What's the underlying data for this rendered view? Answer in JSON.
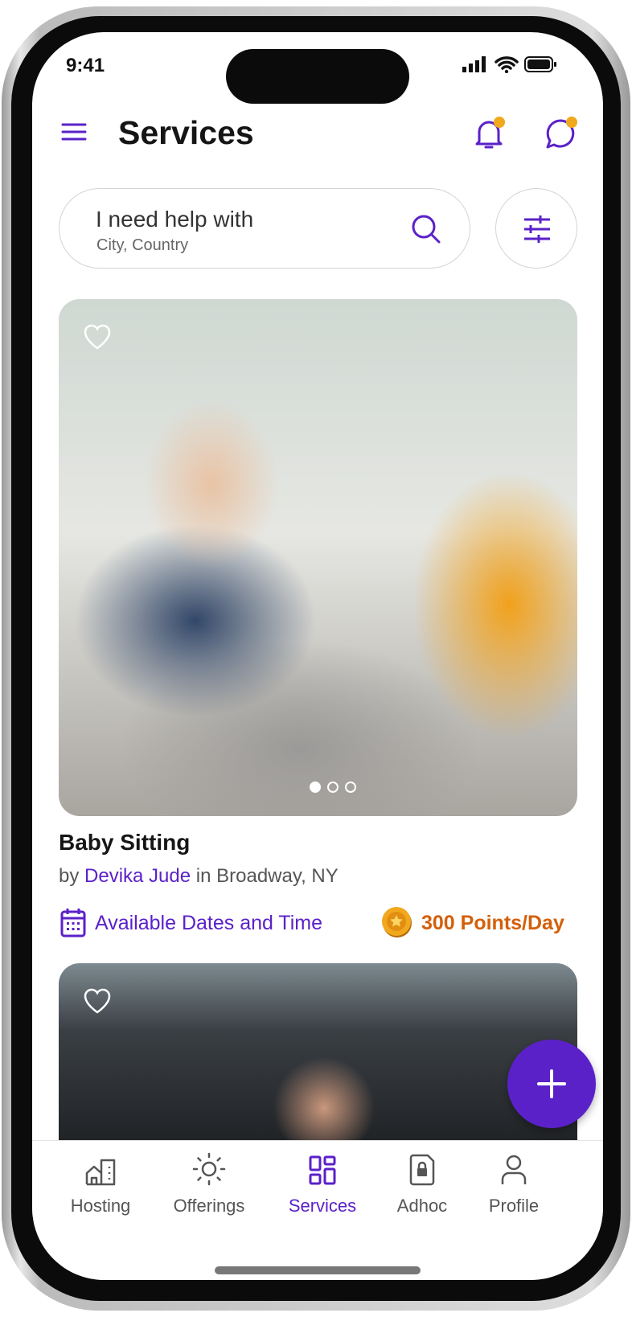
{
  "status_bar": {
    "time": "9:41"
  },
  "header": {
    "title": "Services"
  },
  "search": {
    "label": "I need help with",
    "sublabel": "City, Country"
  },
  "listings": [
    {
      "title": "Baby Sitting",
      "by": "by",
      "provider": "Devika Jude",
      "location_prefix": "in",
      "location": "Broadway, NY",
      "availability": "Available Dates and Time",
      "points": "300 Points/Day",
      "image_count": 3,
      "current_image": 1
    },
    {}
  ],
  "tabs": [
    {
      "label": "Hosting"
    },
    {
      "label": "Offerings"
    },
    {
      "label": "Services",
      "active": true
    },
    {
      "label": "Adhoc"
    },
    {
      "label": "Profile"
    }
  ],
  "colors": {
    "accent": "#5b21c9",
    "points": "#d45f0a",
    "badge": "#f0a81c"
  }
}
